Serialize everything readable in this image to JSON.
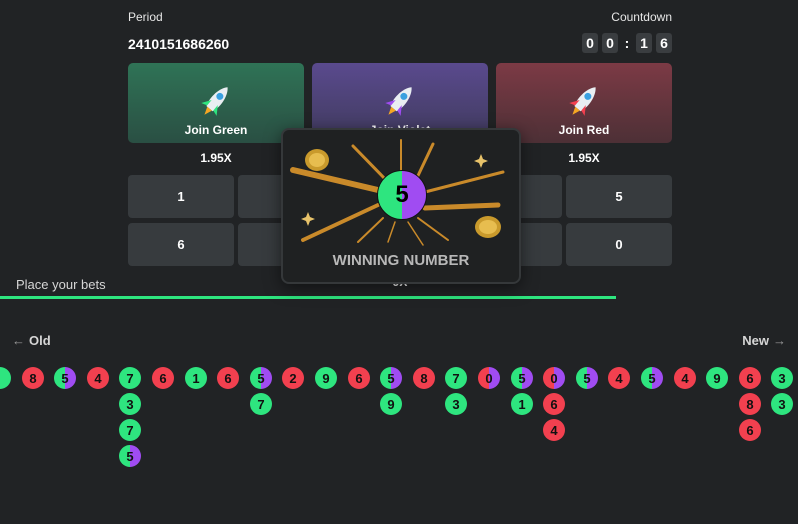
{
  "header": {
    "period_label": "Period",
    "period_value": "2410151686260",
    "countdown_label": "Countdown",
    "countdown_digits": [
      "0",
      "0",
      "1",
      "6"
    ],
    "countdown_sep": ":"
  },
  "join": {
    "green": {
      "label": "Join Green",
      "multiplier": "1.95X",
      "color": "#2e6b52"
    },
    "violet": {
      "label": "Join Violet",
      "multiplier": "",
      "color": "#574585"
    },
    "red": {
      "label": "Join Red",
      "multiplier": "1.95X",
      "color": "#7a3a44"
    }
  },
  "numbers": {
    "row1_left": "1",
    "row1_right": "5",
    "row2_left": "6",
    "row2_right": "0",
    "multiplier": "9X"
  },
  "popup": {
    "number": "5",
    "label": "WINNING NUMBER"
  },
  "status": {
    "place_bets": "Place your bets",
    "progress": 0.88
  },
  "history": {
    "old_label": "Old",
    "new_label": "New",
    "columns": [
      [
        {
          "n": "",
          "c": "g"
        }
      ],
      [
        {
          "n": "8",
          "c": "r"
        }
      ],
      [
        {
          "n": "5",
          "c": "gv"
        }
      ],
      [
        {
          "n": "4",
          "c": "r"
        }
      ],
      [
        {
          "n": "7",
          "c": "g"
        },
        {
          "n": "3",
          "c": "g"
        },
        {
          "n": "7",
          "c": "g"
        },
        {
          "n": "5",
          "c": "gv"
        }
      ],
      [
        {
          "n": "6",
          "c": "r"
        }
      ],
      [
        {
          "n": "1",
          "c": "g"
        }
      ],
      [
        {
          "n": "6",
          "c": "r"
        }
      ],
      [
        {
          "n": "5",
          "c": "gv"
        },
        {
          "n": "7",
          "c": "g"
        }
      ],
      [
        {
          "n": "2",
          "c": "r"
        }
      ],
      [
        {
          "n": "9",
          "c": "g"
        }
      ],
      [
        {
          "n": "6",
          "c": "r"
        }
      ],
      [
        {
          "n": "5",
          "c": "gv"
        },
        {
          "n": "9",
          "c": "g"
        }
      ],
      [
        {
          "n": "8",
          "c": "r"
        }
      ],
      [
        {
          "n": "7",
          "c": "g"
        },
        {
          "n": "3",
          "c": "g"
        }
      ],
      [
        {
          "n": "0",
          "c": "rv"
        }
      ],
      [
        {
          "n": "5",
          "c": "gv"
        },
        {
          "n": "1",
          "c": "g"
        }
      ],
      [
        {
          "n": "0",
          "c": "rv"
        },
        {
          "n": "6",
          "c": "r"
        },
        {
          "n": "4",
          "c": "r"
        }
      ],
      [
        {
          "n": "5",
          "c": "gv"
        }
      ],
      [
        {
          "n": "4",
          "c": "r"
        }
      ],
      [
        {
          "n": "5",
          "c": "gv"
        }
      ],
      [
        {
          "n": "4",
          "c": "r"
        }
      ],
      [
        {
          "n": "9",
          "c": "g"
        }
      ],
      [
        {
          "n": "6",
          "c": "r"
        },
        {
          "n": "8",
          "c": "r"
        },
        {
          "n": "6",
          "c": "r"
        }
      ],
      [
        {
          "n": "3",
          "c": "g"
        },
        {
          "n": "3",
          "c": "g"
        }
      ]
    ]
  }
}
